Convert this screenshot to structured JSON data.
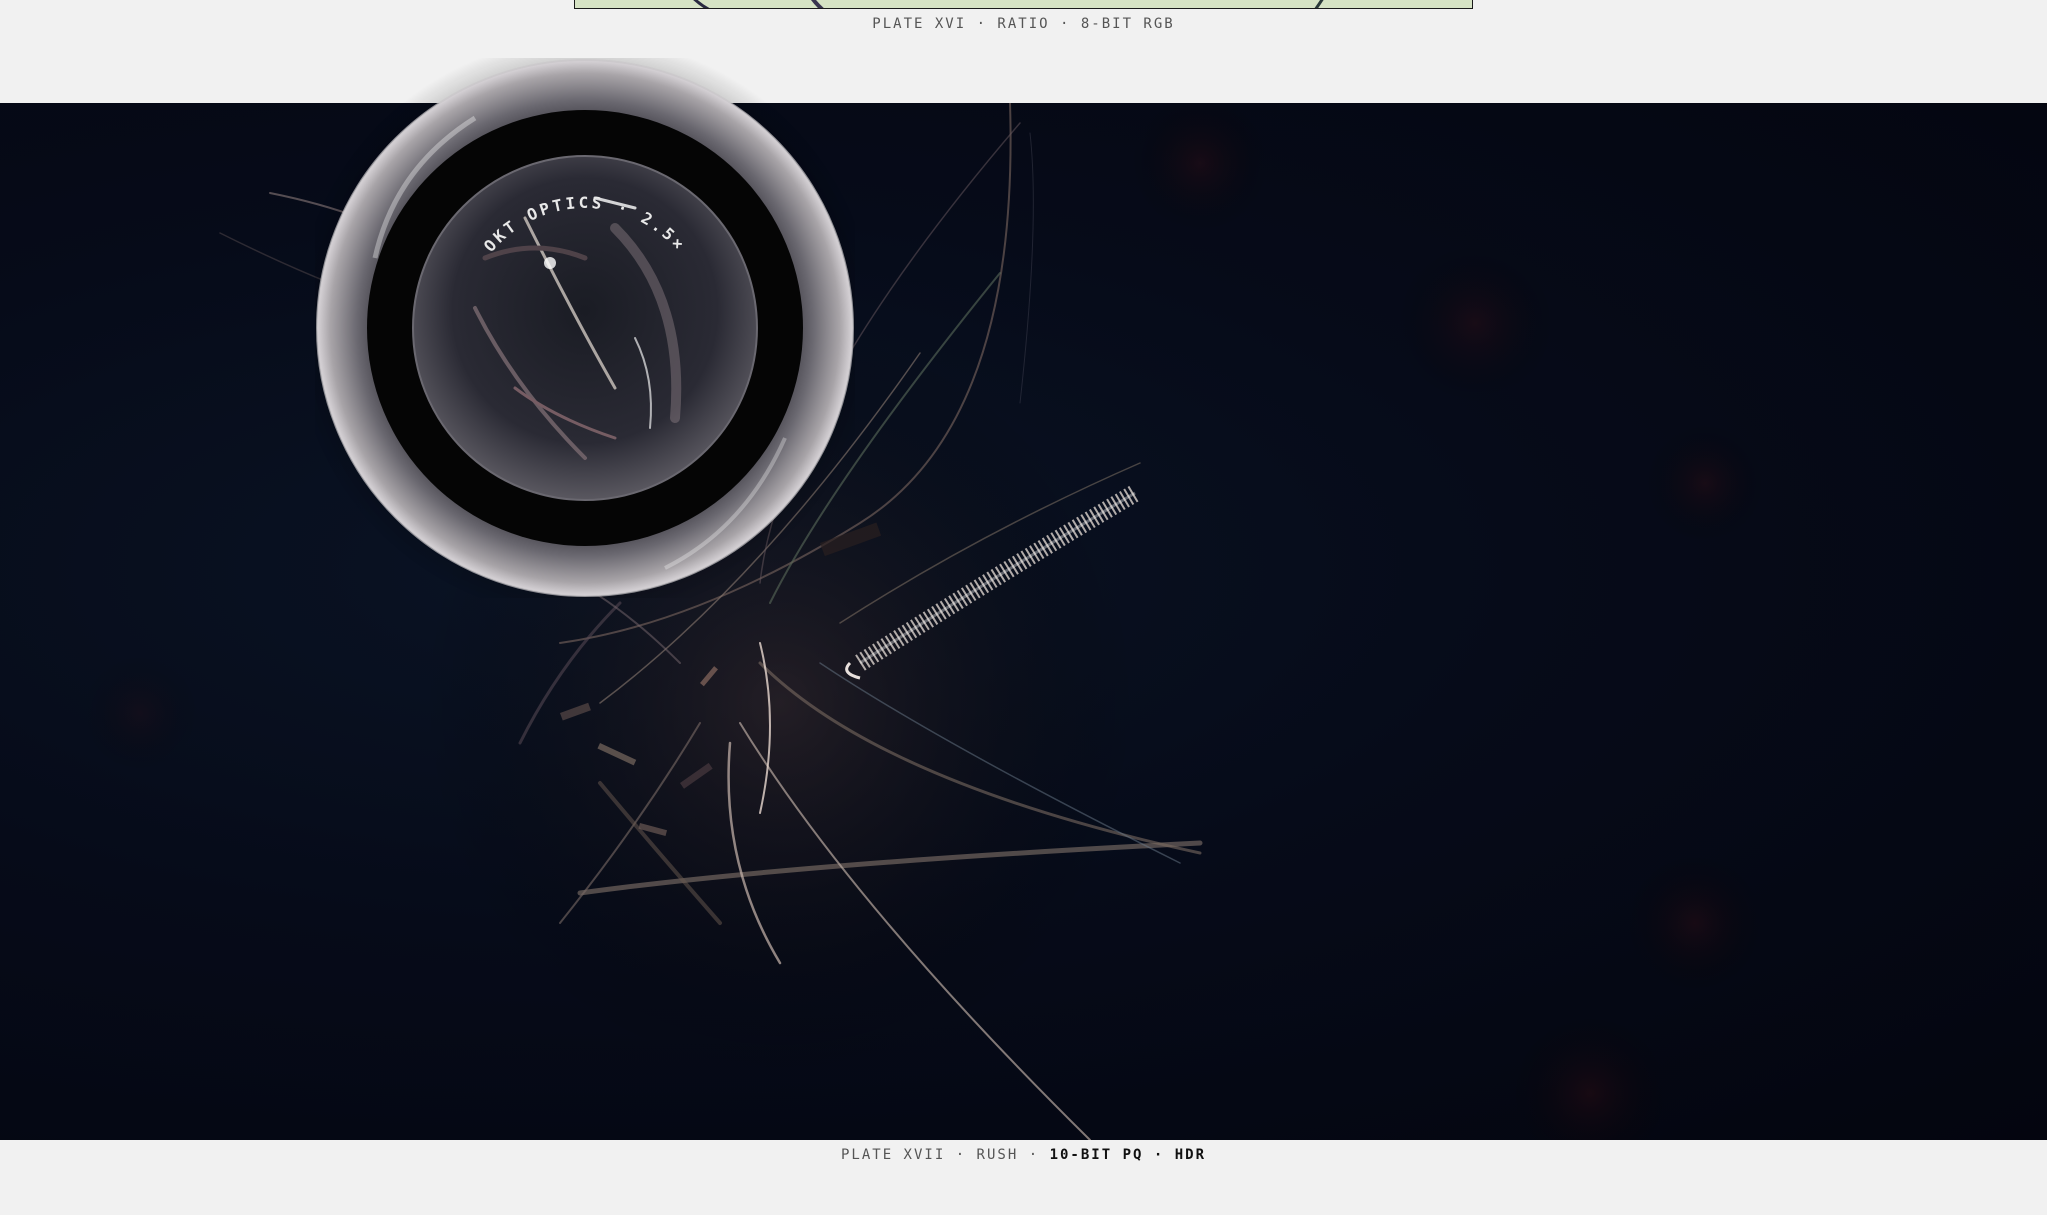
{
  "plates": {
    "top": {
      "caption": "PLATE XVI · RATIO · 8-BIT RGB",
      "background_color": "#d6e3c4"
    },
    "main": {
      "caption_prefix": "PLATE XVII · RUSH · ",
      "caption_emphasis": "10-BIT PQ · HDR",
      "background_color": "#060b19"
    }
  },
  "lens": {
    "label": "OKT OPTICS · 2.5×",
    "icon": "optical-lens-icon"
  },
  "colors": {
    "page_background": "#f1f1f1",
    "caption_text": "#555555",
    "caption_emphasis": "#111111"
  }
}
